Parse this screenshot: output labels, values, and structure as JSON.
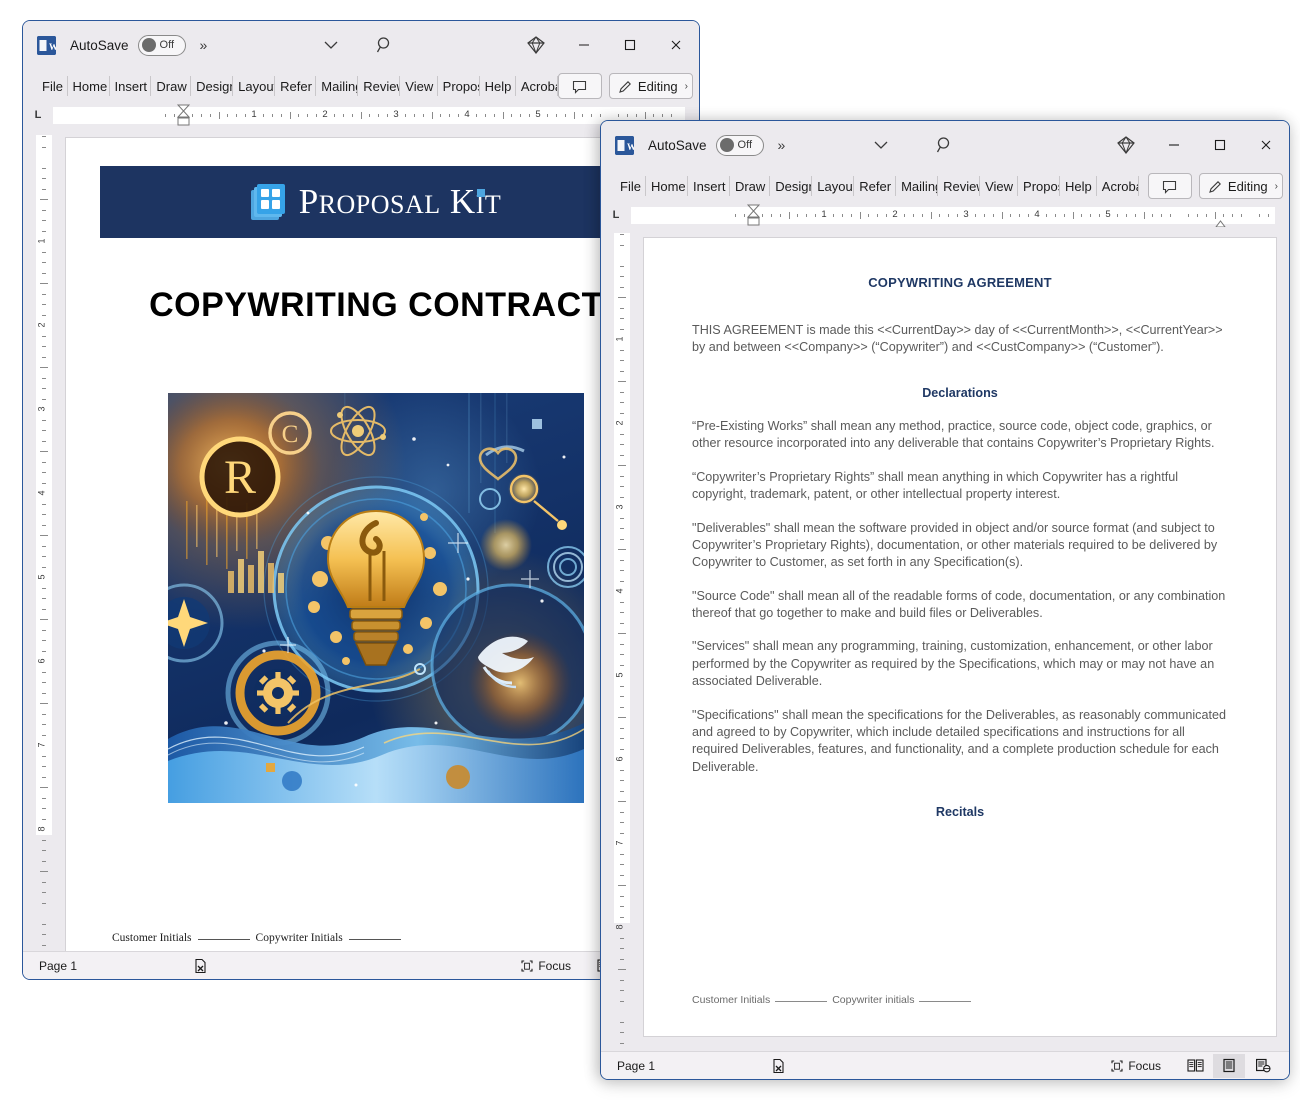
{
  "app": {
    "icon": "word-icon",
    "icon_letter": "W",
    "autosave_label": "AutoSave",
    "autosave_state": "Off",
    "overflow_chevrons": "»",
    "title_caret": "⌄",
    "search_icon": "search-icon",
    "copilot_icon": "copilot-diamond-icon",
    "minimize_label": "─",
    "maximize_label": "□",
    "close_label": "✕"
  },
  "ribbon": {
    "tabs": [
      {
        "label": "File"
      },
      {
        "label": "Home"
      },
      {
        "label": "Insert"
      },
      {
        "label": "Draw"
      },
      {
        "label": "Design"
      },
      {
        "label": "Layout"
      },
      {
        "label": "Refer"
      },
      {
        "label": "Mailings"
      },
      {
        "label": "Review"
      },
      {
        "label": "View"
      },
      {
        "label": "Proposal"
      },
      {
        "label": "Help"
      },
      {
        "label": "Acrobat"
      }
    ],
    "comments_icon": "comment-bubble-icon",
    "editing_label": "Editing",
    "editing_icon": "pencil-icon",
    "editing_caret": "›"
  },
  "ruler": {
    "tabstop_glyph": "L",
    "h_numbers": [
      "1",
      "2",
      "3",
      "4",
      "5"
    ],
    "v_numbers": [
      "1",
      "2",
      "3",
      "4",
      "5",
      "6",
      "7",
      "8"
    ]
  },
  "statusbar": {
    "page_label": "Page 1",
    "accessibility_icon": "accessibility-check-icon",
    "focus_label": "Focus",
    "focus_icon": "focus-icon",
    "view_read_icon": "read-mode-icon",
    "view_print_icon": "print-layout-icon",
    "view_web_icon": "web-layout-icon"
  },
  "window_back": {
    "name": "copywriting-contract-cover-window",
    "document": {
      "banner": {
        "brand": "Proposal Kit",
        "brand_parts": {
          "p1": "P",
          "p2": "ROPOSAL",
          "k1": "K",
          "k2": "I",
          "k3": "T"
        },
        "background_color": "#1d3461",
        "logo_icon": "proposal-kit-document-stack-icon"
      },
      "title": "COPYWRITING CONTRACT",
      "cover_art": {
        "name": "copywriting-cover-illustration",
        "description": "Abstract blue and gold illustration with glowing lightbulb, registered trademark symbol, copyright symbol, atom, gears, dove and waves",
        "symbols": [
          "®",
          "©"
        ],
        "palette": {
          "deep_blue": "#12306b",
          "mid_blue": "#1b4d9e",
          "light_blue": "#6fc2f0",
          "gold": "#f3b63a",
          "bright_gold": "#ffd87a",
          "amber": "#d9821f"
        }
      },
      "footer": {
        "customer_label": "Customer Initials",
        "copywriter_label": "Copywriter Initials"
      }
    }
  },
  "window_front": {
    "name": "copywriting-agreement-window",
    "document": {
      "heading": "COPYWRITING AGREEMENT",
      "intro": "THIS AGREEMENT is made this <<CurrentDay>> day of <<CurrentMonth>>, <<CurrentYear>> by and between <<Company>> (“Copywriter”) and <<CustCompany>> (“Customer”).",
      "sections": [
        {
          "title": "Declarations",
          "paragraphs": [
            "“Pre-Existing Works” shall mean any method, practice, source code, object code, graphics, or other resource incorporated into any deliverable that contains Copywriter’s Proprietary Rights.",
            "“Copywriter’s Proprietary Rights” shall mean anything in which Copywriter has a rightful copyright, trademark, patent, or other intellectual property interest.",
            "\"Deliverables\" shall mean the software provided in object and/or source format (and subject to Copywriter’s Proprietary Rights), documentation, or other materials required to be delivered by Copywriter to Customer, as set forth in any Specification(s).",
            "\"Source Code\" shall mean all of the readable forms of code, documentation, or any combination thereof that go together to make and build files or Deliverables.",
            "\"Services\" shall mean any programming, training, customization, enhancement, or other labor performed by the Copywriter as required by the Specifications, which may or may not have an associated Deliverable.",
            "\"Specifications\" shall mean the specifications for the Deliverables, as reasonably communicated and agreed to by Copywriter, which include detailed specifications and instructions for all required Deliverables, features, and functionality, and a complete production schedule for each Deliverable."
          ]
        },
        {
          "title": "Recitals",
          "paragraphs": []
        }
      ],
      "footer": {
        "customer_label": "Customer Initials",
        "copywriter_label": "Copywriter initials"
      }
    }
  }
}
